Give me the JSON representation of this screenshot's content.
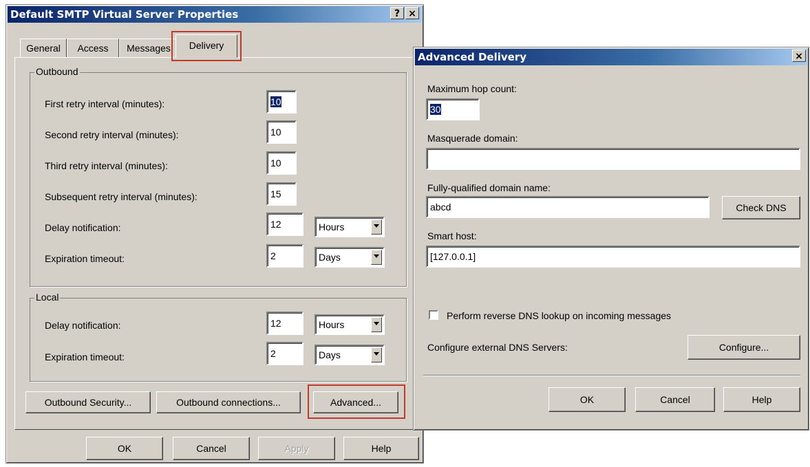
{
  "smtp_dialog": {
    "title": "Default SMTP Virtual Server Properties",
    "help_btn": "?",
    "close_btn": "×",
    "tabs": [
      {
        "label": "General"
      },
      {
        "label": "Access"
      },
      {
        "label": "Messages"
      },
      {
        "label": "Delivery"
      }
    ],
    "outbound": {
      "title": "Outbound",
      "first_retry_label": "First retry interval (minutes):",
      "first_retry_value": "10",
      "second_retry_label": "Second retry interval (minutes):",
      "second_retry_value": "10",
      "third_retry_label": "Third retry interval (minutes):",
      "third_retry_value": "10",
      "subsequent_retry_label": "Subsequent retry interval (minutes):",
      "subsequent_retry_value": "15",
      "delay_label": "Delay notification:",
      "delay_value": "12",
      "delay_unit": "Hours",
      "expiration_label": "Expiration timeout:",
      "expiration_value": "2",
      "expiration_unit": "Days"
    },
    "local": {
      "title": "Local",
      "delay_label": "Delay notification:",
      "delay_value": "12",
      "delay_unit": "Hours",
      "expiration_label": "Expiration timeout:",
      "expiration_value": "2",
      "expiration_unit": "Days"
    },
    "buttons": {
      "outbound_security": "Outbound Security...",
      "outbound_connections": "Outbound connections...",
      "advanced": "Advanced...",
      "ok": "OK",
      "cancel": "Cancel",
      "apply": "Apply",
      "help": "Help"
    }
  },
  "advanced_dialog": {
    "title": "Advanced Delivery",
    "close_btn": "×",
    "max_hop_label": "Maximum hop count:",
    "max_hop_value": "30",
    "masquerade_label": "Masquerade domain:",
    "masquerade_value": "",
    "fqdn_label": "Fully-qualified domain name:",
    "fqdn_value": "abcd",
    "check_dns": "Check DNS",
    "smart_host_label": "Smart host:",
    "smart_host_value": "[127.0.0.1]",
    "reverse_dns_label": "Perform reverse DNS lookup on incoming messages",
    "reverse_dns_checked": false,
    "external_dns_label": "Configure external DNS Servers:",
    "configure": "Configure...",
    "ok": "OK",
    "cancel": "Cancel",
    "help": "Help"
  },
  "colors": {
    "dialog_face": "#d4d0c8",
    "title_active": "#0a246a",
    "highlight_box": "#c0392b"
  }
}
